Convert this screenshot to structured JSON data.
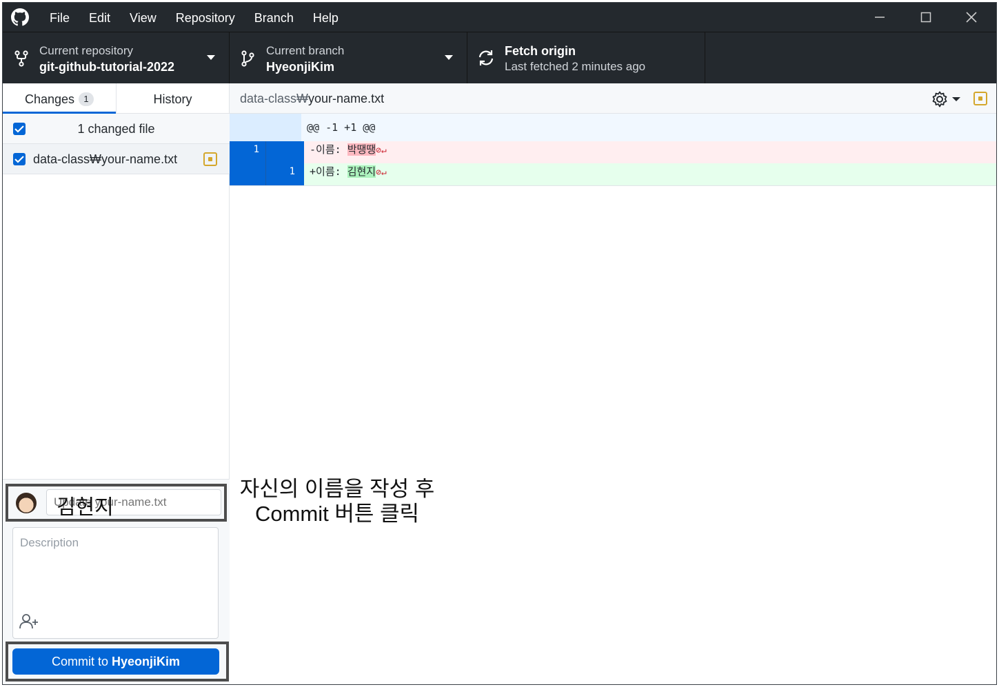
{
  "menu": [
    "File",
    "Edit",
    "View",
    "Repository",
    "Branch",
    "Help"
  ],
  "toolbar": {
    "repo_label": "Current repository",
    "repo_value": "git-github-tutorial-2022",
    "branch_label": "Current branch",
    "branch_value": "HyeonjiKim",
    "fetch_title": "Fetch origin",
    "fetch_sub": "Last fetched 2 minutes ago"
  },
  "sidebar": {
    "tab_changes": "Changes",
    "tab_changes_count": "1",
    "tab_history": "History",
    "changed_count": "1 changed file",
    "file_name": "data-class₩your-name.txt"
  },
  "commit": {
    "summary_placeholder": "Update your-name.txt",
    "summary_value": "김현지",
    "description_placeholder": "Description",
    "button_prefix": "Commit to ",
    "button_branch": "HyeonjiKim"
  },
  "annotation": [
    "자신의 이름을 작성 후",
    "Commit 버튼 클릭"
  ],
  "diff": {
    "path_dir": "data-class₩",
    "path_file": "your-name.txt",
    "hunk": "@@ -1 +1 @@",
    "lines": [
      {
        "type": "del",
        "old": "1",
        "new": "",
        "prefix": "-이름: ",
        "changed": "박땡땡",
        "eol": "⊘↵"
      },
      {
        "type": "add",
        "old": "",
        "new": "1",
        "prefix": "+이름: ",
        "changed": "김현지",
        "eol": "⊘↵"
      }
    ]
  },
  "colors": {
    "titlebar": "#24292e",
    "accent": "#0366d6",
    "modified": "#d4a72c",
    "deleted_bg": "#ffeef0",
    "added_bg": "#e6ffed"
  }
}
